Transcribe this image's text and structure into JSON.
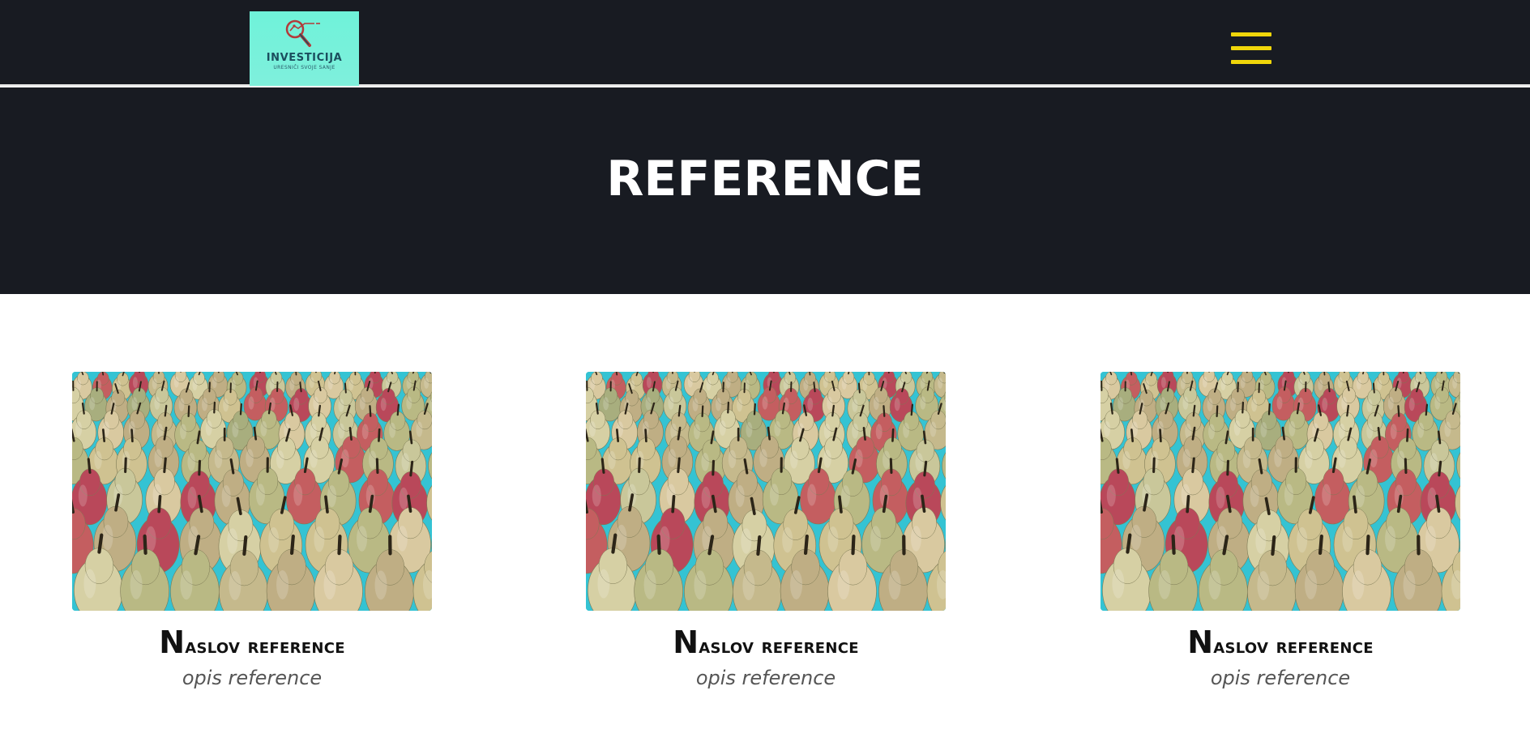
{
  "header": {
    "logo": {
      "title": "INVESTICIJA",
      "subtitle": "URESNIČI SVOJE SANJE"
    },
    "menu_icon": "hamburger-menu-icon",
    "accent_color": "#f0d60a",
    "background_color": "#181b22"
  },
  "hero": {
    "title": "REFERENCE"
  },
  "references": [
    {
      "title_initial": "N",
      "title_rest": "aslov reference",
      "description": "opis reference",
      "image": "pears-photo"
    },
    {
      "title_initial": "N",
      "title_rest": "aslov reference",
      "description": "opis reference",
      "image": "pears-photo"
    },
    {
      "title_initial": "N",
      "title_rest": "aslov reference",
      "description": "opis reference",
      "image": "pears-photo"
    }
  ]
}
